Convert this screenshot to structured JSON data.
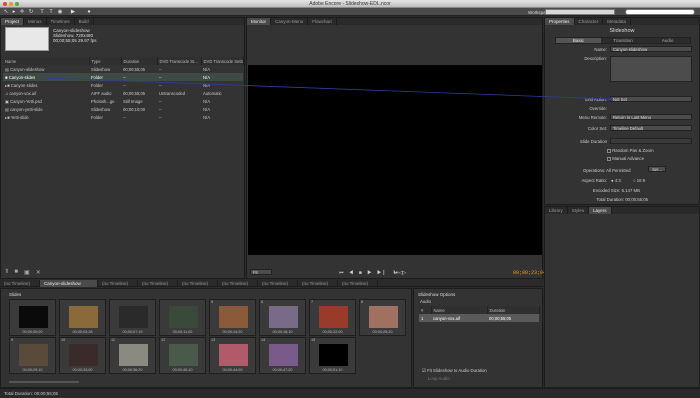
{
  "window": {
    "title": "Adobe Encore - Slideshow-EDL.ncor"
  },
  "toolbar": {
    "workspace_label": "Workspace:"
  },
  "project_panel": {
    "tabs": [
      "Project",
      "Menus",
      "Timelines",
      "Build"
    ],
    "info": {
      "name": "Canyon-slideshow",
      "line2": "Slideshow, 720x480",
      "line3": "00;00;55;05 29.97 fps"
    },
    "columns": [
      "Name",
      "Type",
      "Duration",
      "DVD Transcode St...",
      "DVD Transcode Settin"
    ],
    "rows": [
      {
        "name": "Canyon-slideshow",
        "type": "Slideshow",
        "duration": "00;00;55;05",
        "status": "--",
        "settings": "N/A"
      },
      {
        "name": "Canyon-slides",
        "type": "Folder",
        "duration": "--",
        "status": "--",
        "settings": "N/A"
      },
      {
        "name": "Canyon-slides",
        "type": "Folder",
        "duration": "--",
        "status": "--",
        "settings": "N/A"
      },
      {
        "name": "canyon-vox.aif",
        "type": "AIFF audio",
        "duration": "00;00;55;05",
        "status": "Untranscoded",
        "settings": "Automatic"
      },
      {
        "name": "Canyon-Yetti.psd",
        "type": "Photosh...ge",
        "duration": "Still Image",
        "status": "--",
        "settings": "N/A"
      },
      {
        "name": "canyon-yetti-slide",
        "type": "Slideshow",
        "duration": "00;00;10;00",
        "status": "--",
        "settings": "N/A"
      },
      {
        "name": "Yetti-slide",
        "type": "Folder",
        "duration": "--",
        "status": "--",
        "settings": "N/A"
      }
    ]
  },
  "monitor_panel": {
    "tabs": [
      "Monitor",
      "Canyon-Menu",
      "Flowchart"
    ],
    "zoom": "Fit",
    "timecode": "00;00;23;04"
  },
  "timeline_tabs": [
    "(no Timeline)",
    "Canyon-slideshow",
    "(no Timeline)",
    "(no Timeline)",
    "(no Timeline)",
    "(no Timeline)",
    "(no Timeline)",
    "(no Timeline)",
    "(no Timeline)"
  ],
  "slides_panel": {
    "label": "Slides",
    "slides": [
      {
        "num": "",
        "dur": "00;00;00;00",
        "color": "#0a0a0a"
      },
      {
        "num": "",
        "dur": "00;00;03;28",
        "color": "#8a6a3a"
      },
      {
        "num": "",
        "dur": "00;00;07;19",
        "color": "#2a2a2a"
      },
      {
        "num": "",
        "dur": "00;00;11;00",
        "color": "#3a4a3a"
      },
      {
        "num": "5",
        "dur": "00;00;14;20",
        "color": "#8a5a3a"
      },
      {
        "num": "6",
        "dur": "00;00;18;10",
        "color": "#7a6a8a"
      },
      {
        "num": "7",
        "dur": "00;00;22;00",
        "color": "#9a3a2a"
      },
      {
        "num": "8",
        "dur": "00;00;25;20",
        "color": "#a07060"
      },
      {
        "num": "9",
        "dur": "00;00;29;10",
        "color": "#5a4a3a"
      },
      {
        "num": "10",
        "dur": "00;00;33;00",
        "color": "#3a2a2a"
      },
      {
        "num": "11",
        "dur": "00;00;36;20",
        "color": "#8a8a80"
      },
      {
        "num": "12",
        "dur": "00;00;40;10",
        "color": "#4a5a4a"
      },
      {
        "num": "13",
        "dur": "00;00;44;00",
        "color": "#b05a6a"
      },
      {
        "num": "14",
        "dur": "00;00;47;20",
        "color": "#7a5a8a"
      },
      {
        "num": "15",
        "dur": "00;00;51;10",
        "color": "#000000"
      }
    ]
  },
  "slideshow_options": {
    "title": "Slideshow Options",
    "audio_label": "Audio",
    "columns": [
      "#",
      "Name",
      "Duration"
    ],
    "rows": [
      {
        "num": "1",
        "name": "canyon-vox.aif",
        "duration": "00;00;55;05"
      }
    ],
    "fit_label": "Fit Slideshow to Audio Duration",
    "loop_label": "Loop Audio"
  },
  "properties_panel": {
    "tabs": [
      "Properties",
      "Character",
      "Metadata"
    ],
    "header": "Slideshow",
    "subtabs": [
      "Basic",
      "Transition",
      "Audio"
    ],
    "name_label": "Name:",
    "name_value": "Canyon-slideshow",
    "description_label": "Description:",
    "end_action_label": "End Action:",
    "end_action_value": "Not Set",
    "override_label": "Override:",
    "menu_remote_label": "Menu Remote:",
    "menu_remote_value": "Return to Last Menu",
    "color_set_label": "Color Set:",
    "color_set_value": "Timeline Default",
    "slide_duration_label": "Slide Duration",
    "random_label": "Random Pan & Zoom",
    "manual_label": "Manual Advance",
    "operations_label": "Operations: All Permitted",
    "set_button": "Set...",
    "aspect_label": "Aspect Ratio:",
    "aspect_43": "4:3",
    "aspect_169": "16:9",
    "encoded_label": "Encoded Size: 5.147 MB",
    "total_duration_label": "Total Duration: 00;00;55;05"
  },
  "library_panel": {
    "tabs": [
      "Library",
      "Styles",
      "Layers"
    ]
  },
  "status": {
    "total_duration": "Total Duration: 00;00;55;05"
  },
  "colors": {
    "accent": "#e7a11a",
    "link_line": "#2b3f9e"
  }
}
